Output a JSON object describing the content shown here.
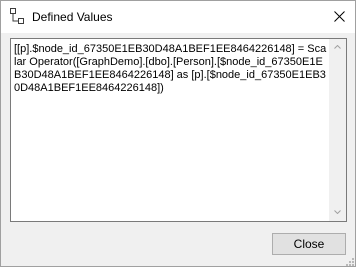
{
  "window": {
    "title": "Defined Values",
    "title_icon": "tree-node-icon",
    "close_icon": "close-icon"
  },
  "content": {
    "text": "[[p].$node_id_67350E1EB30D48A1BEF1EE8464226148] = Scalar Operator([GraphDemo].[dbo].[Person].[$node_id_67350E1EB30D48A1BEF1EE8464226148] as [p].[$node_id_67350E1EB30D48A1BEF1EE8464226148])"
  },
  "buttons": {
    "close_label": "Close"
  },
  "colors": {
    "dialog_background": "#f0f0f0",
    "text_background": "#ffffff",
    "button_background": "#e1e1e1",
    "button_border": "#adadad"
  }
}
